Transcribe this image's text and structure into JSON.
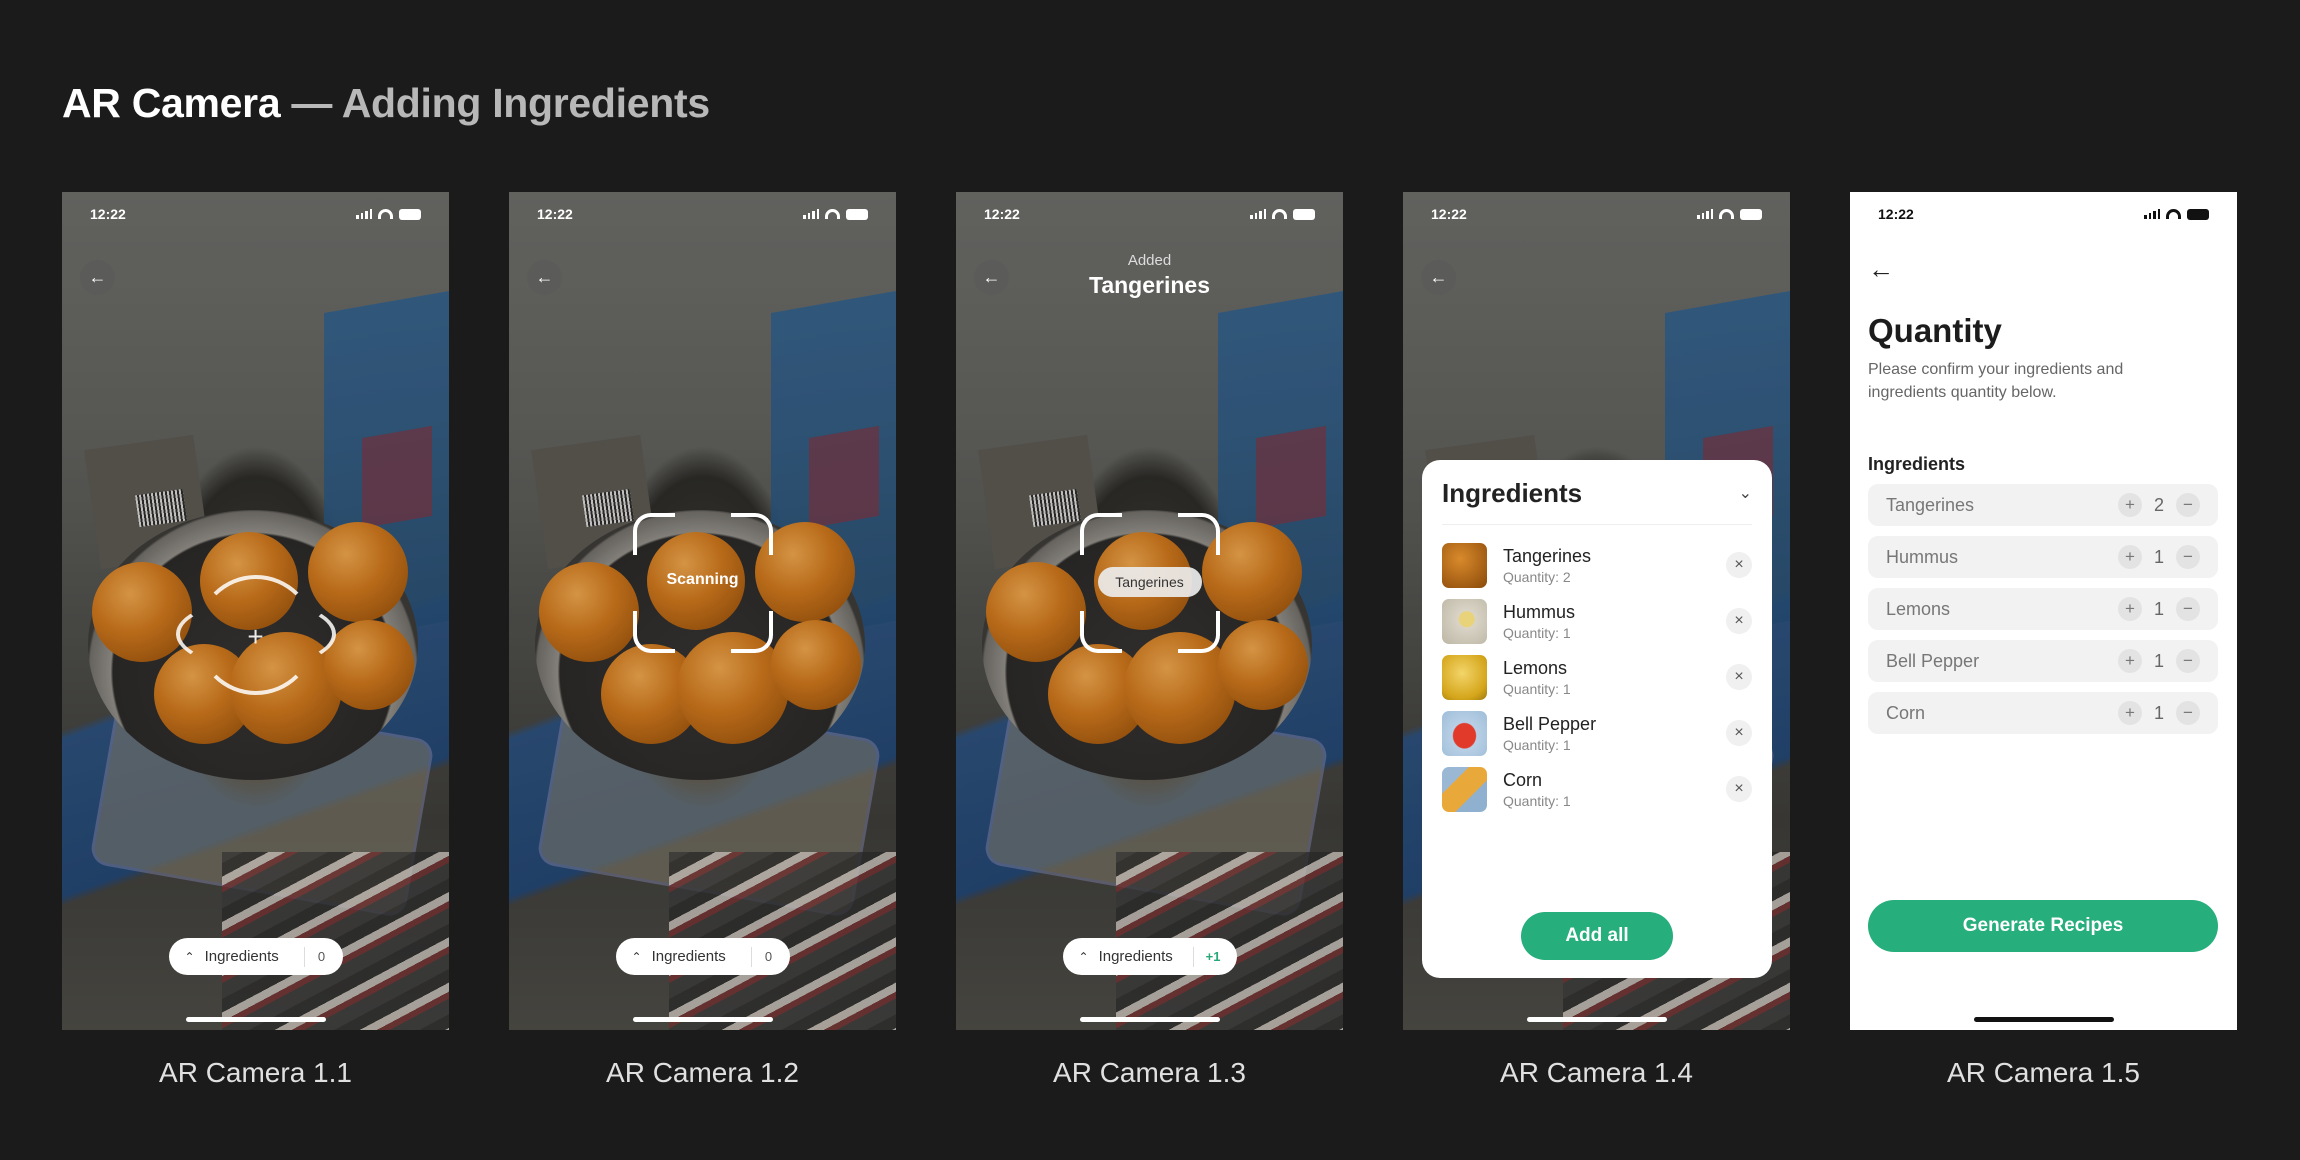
{
  "title": {
    "primary": "AR Camera",
    "dash": " — ",
    "secondary": "Adding Ingredients"
  },
  "status_time": "12:22",
  "screens": [
    {
      "caption": "AR Camera 1.1",
      "chip": {
        "label": "Ingredients",
        "count": "0"
      }
    },
    {
      "caption": "AR Camera 1.2",
      "scan_label": "Scanning",
      "chip": {
        "label": "Ingredients",
        "count": "0"
      }
    },
    {
      "caption": "AR Camera 1.3",
      "added_label": "Added",
      "added_item": "Tangerines",
      "tag": "Tangerines",
      "chip": {
        "label": "Ingredients",
        "count": "+1"
      }
    },
    {
      "caption": "AR Camera 1.4",
      "sheet_title": "Ingredients",
      "items": [
        {
          "name": "Tangerines",
          "qty": "Quantity: 2"
        },
        {
          "name": "Hummus",
          "qty": "Quantity: 1"
        },
        {
          "name": "Lemons",
          "qty": "Quantity: 1"
        },
        {
          "name": "Bell Pepper",
          "qty": "Quantity: 1"
        },
        {
          "name": "Corn",
          "qty": "Quantity: 1"
        }
      ],
      "add_all": "Add all"
    },
    {
      "caption": "AR Camera 1.5",
      "heading": "Quantity",
      "subtitle": "Please confirm your ingredients and ingredients quantity below.",
      "list_label": "Ingredients",
      "rows": [
        {
          "name": "Tangerines",
          "count": "2"
        },
        {
          "name": "Hummus",
          "count": "1"
        },
        {
          "name": "Lemons",
          "count": "1"
        },
        {
          "name": "Bell Pepper",
          "count": "1"
        },
        {
          "name": "Corn",
          "count": "1"
        }
      ],
      "cta": "Generate Recipes"
    }
  ],
  "colors": {
    "background": "#1b1b1b",
    "accent": "#26ae7c",
    "secondary_title": "#b8b8b8"
  },
  "icons": [
    "back-arrow-icon",
    "chevron-up-icon",
    "chevron-down-icon",
    "close-icon",
    "plus-icon",
    "minus-icon",
    "signal-icon",
    "wifi-icon",
    "battery-icon",
    "location-arrow-icon"
  ]
}
